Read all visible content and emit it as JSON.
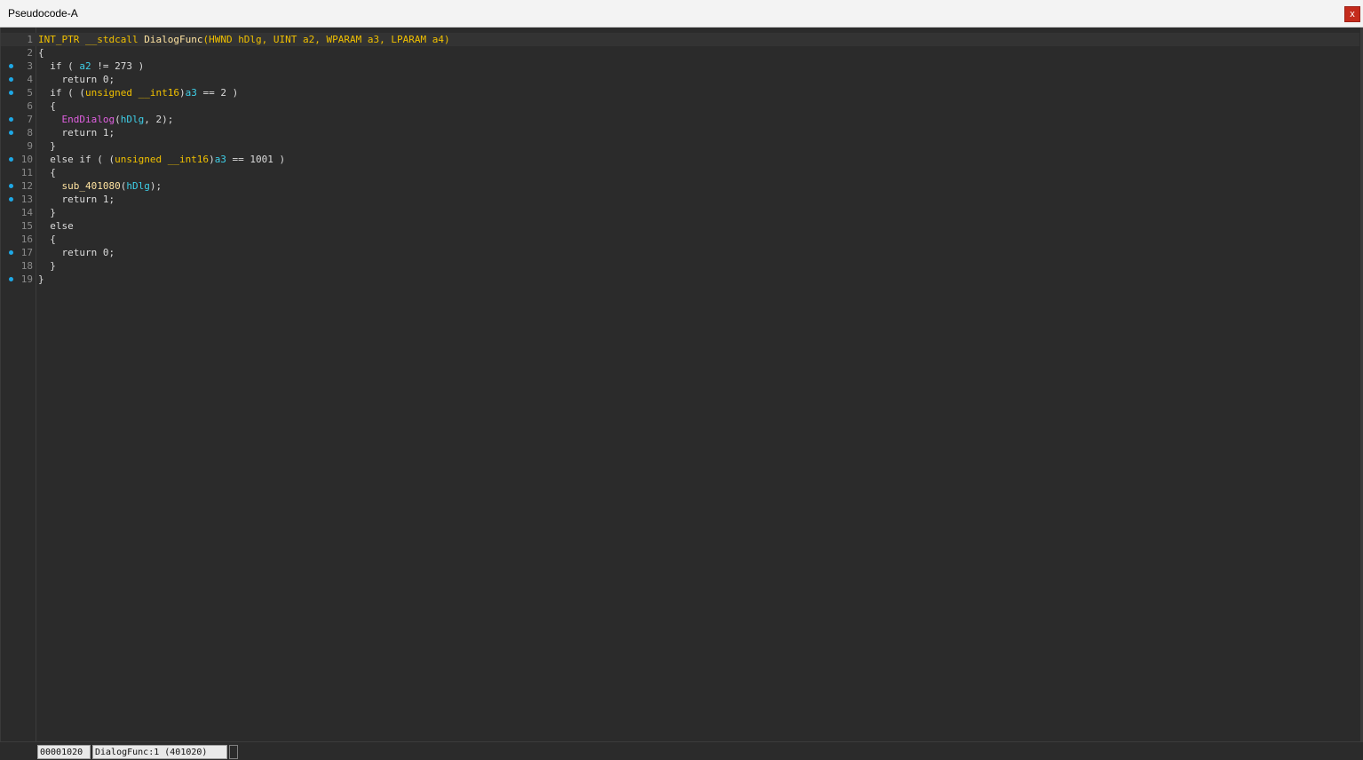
{
  "window": {
    "title": "Pseudocode-A",
    "close_label": "x"
  },
  "code": {
    "lines": [
      {
        "num": "1",
        "bp": false,
        "tokens": [
          [
            "type",
            "INT_PTR __stdcall "
          ],
          [
            "func",
            "DialogFunc"
          ],
          [
            "type",
            "(HWND hDlg, UINT a2, WPARAM a3, LPARAM a4)"
          ]
        ]
      },
      {
        "num": "2",
        "bp": false,
        "tokens": [
          [
            "plain",
            "{"
          ]
        ]
      },
      {
        "num": "3",
        "bp": true,
        "tokens": [
          [
            "plain",
            "  if ( "
          ],
          [
            "var",
            "a2"
          ],
          [
            "plain",
            " != 273 )"
          ]
        ]
      },
      {
        "num": "4",
        "bp": true,
        "tokens": [
          [
            "plain",
            "    return 0;"
          ]
        ]
      },
      {
        "num": "5",
        "bp": true,
        "tokens": [
          [
            "plain",
            "  if ( ("
          ],
          [
            "type",
            "unsigned __int16"
          ],
          [
            "plain",
            ")"
          ],
          [
            "var",
            "a3"
          ],
          [
            "plain",
            " == 2 )"
          ]
        ]
      },
      {
        "num": "6",
        "bp": false,
        "tokens": [
          [
            "plain",
            "  {"
          ]
        ]
      },
      {
        "num": "7",
        "bp": true,
        "tokens": [
          [
            "plain",
            "    "
          ],
          [
            "import",
            "EndDialog"
          ],
          [
            "plain",
            "("
          ],
          [
            "var",
            "hDlg"
          ],
          [
            "plain",
            ", 2);"
          ]
        ]
      },
      {
        "num": "8",
        "bp": true,
        "tokens": [
          [
            "plain",
            "    return 1;"
          ]
        ]
      },
      {
        "num": "9",
        "bp": false,
        "tokens": [
          [
            "plain",
            "  }"
          ]
        ]
      },
      {
        "num": "10",
        "bp": true,
        "tokens": [
          [
            "plain",
            "  else if ( ("
          ],
          [
            "type",
            "unsigned __int16"
          ],
          [
            "plain",
            ")"
          ],
          [
            "var",
            "a3"
          ],
          [
            "plain",
            " == 1001 )"
          ]
        ]
      },
      {
        "num": "11",
        "bp": false,
        "tokens": [
          [
            "plain",
            "  {"
          ]
        ]
      },
      {
        "num": "12",
        "bp": true,
        "tokens": [
          [
            "plain",
            "    "
          ],
          [
            "func",
            "sub_401080"
          ],
          [
            "plain",
            "("
          ],
          [
            "var",
            "hDlg"
          ],
          [
            "plain",
            ");"
          ]
        ]
      },
      {
        "num": "13",
        "bp": true,
        "tokens": [
          [
            "plain",
            "    return 1;"
          ]
        ]
      },
      {
        "num": "14",
        "bp": false,
        "tokens": [
          [
            "plain",
            "  }"
          ]
        ]
      },
      {
        "num": "15",
        "bp": false,
        "tokens": [
          [
            "plain",
            "  else"
          ]
        ]
      },
      {
        "num": "16",
        "bp": false,
        "tokens": [
          [
            "plain",
            "  {"
          ]
        ]
      },
      {
        "num": "17",
        "bp": true,
        "tokens": [
          [
            "plain",
            "    return 0;"
          ]
        ]
      },
      {
        "num": "18",
        "bp": false,
        "tokens": [
          [
            "plain",
            "  }"
          ]
        ]
      },
      {
        "num": "19",
        "bp": true,
        "tokens": [
          [
            "plain",
            "}"
          ]
        ]
      }
    ]
  },
  "status": {
    "address": "00001020",
    "location": "DialogFunc:1 (401020)"
  },
  "colors": {
    "background": "#2b2b2b",
    "keyword_type": "#f0c000",
    "variable": "#3ecfe8",
    "import_func": "#e060e0",
    "breakpoint_dot": "#1ea8e6",
    "close_button": "#c42b1c"
  }
}
